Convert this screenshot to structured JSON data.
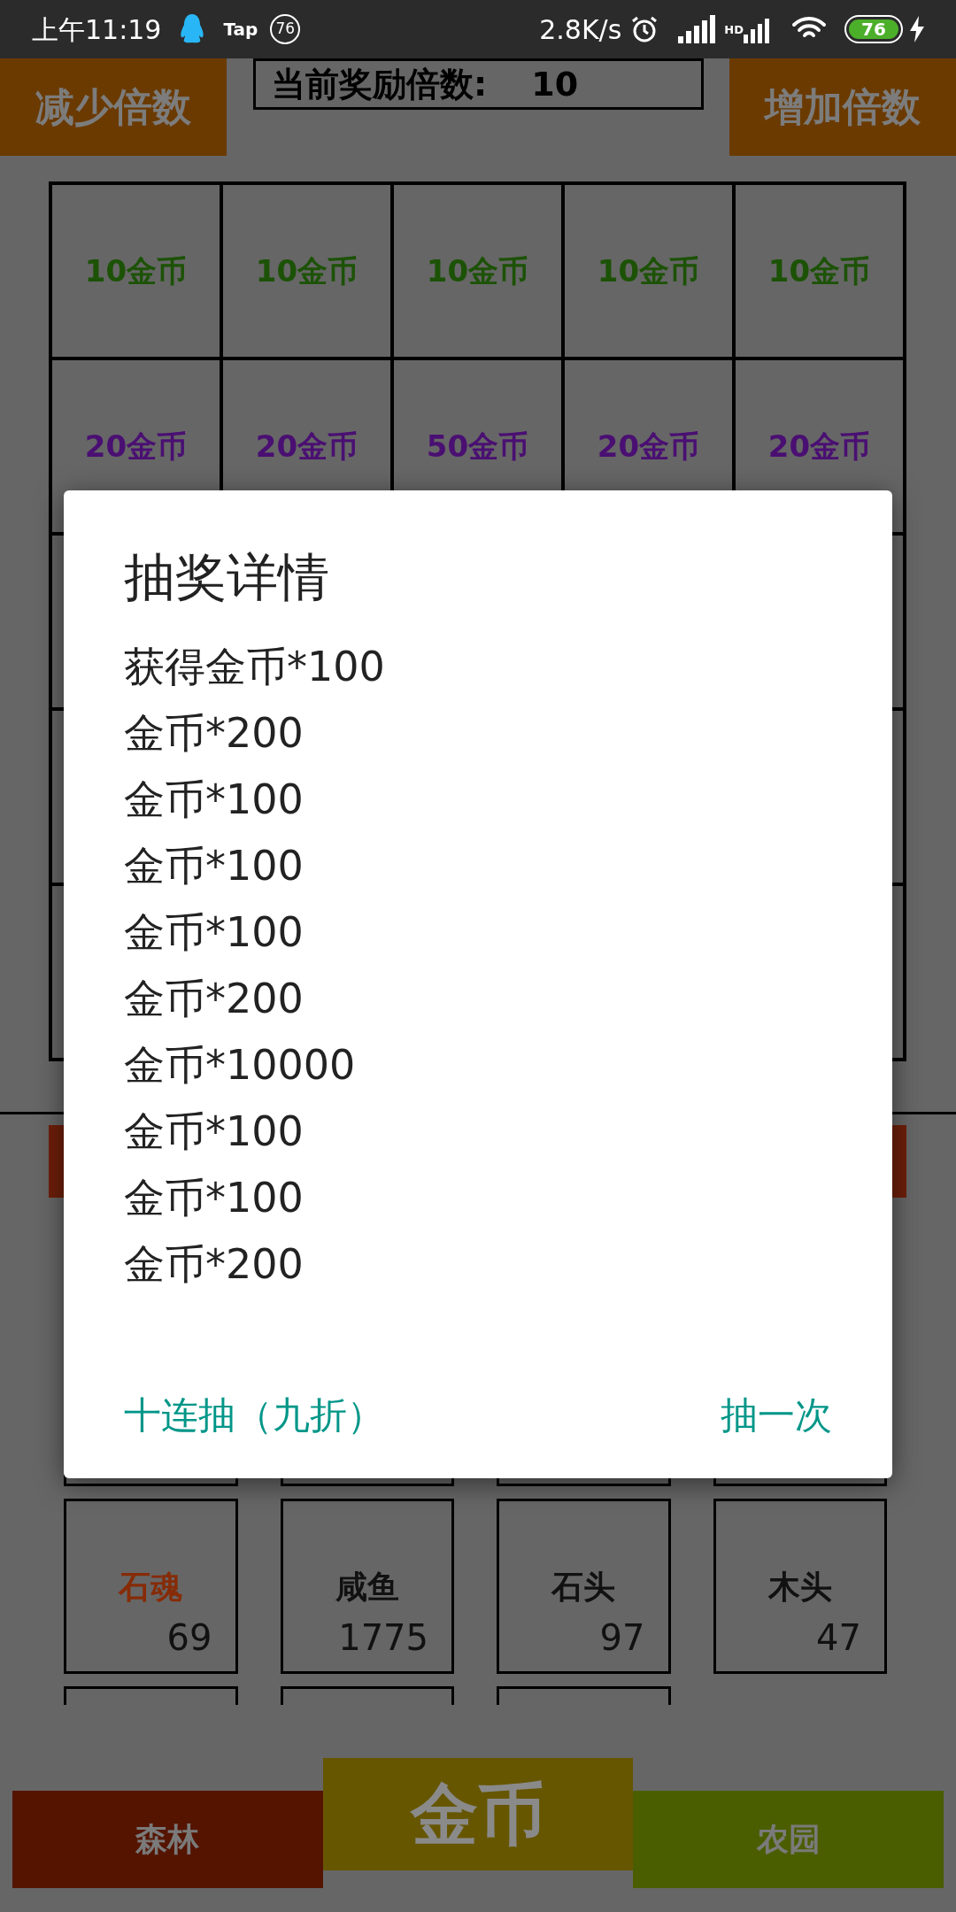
{
  "status_bar": {
    "time": "上午11:19",
    "app_label": "Tap",
    "badge": "76",
    "speed": "2.8K/s",
    "hd": "HD",
    "battery": "76"
  },
  "header": {
    "decrease": "减少倍数",
    "multiplier_label": "当前奖励倍数:",
    "multiplier_value": "10",
    "increase": "增加倍数"
  },
  "prize_grid": [
    [
      {
        "label": "10金币",
        "color": "#1c5206"
      },
      {
        "label": "10金币",
        "color": "#1c5206"
      },
      {
        "label": "10金币",
        "color": "#1c5206"
      },
      {
        "label": "10金币",
        "color": "#1c5206"
      },
      {
        "label": "10金币",
        "color": "#1c5206"
      }
    ],
    [
      {
        "label": "20金币",
        "color": "#4a0f72"
      },
      {
        "label": "20金币",
        "color": "#4a0f72"
      },
      {
        "label": "50金币",
        "color": "#4a0f72"
      },
      {
        "label": "20金币",
        "color": "#4a0f72"
      },
      {
        "label": "20金币",
        "color": "#4a0f72"
      }
    ]
  ],
  "items": [
    {
      "name": "石魂",
      "count": "69",
      "color": "#862b06"
    },
    {
      "name": "咸鱼",
      "count": "1775",
      "color": "#111111"
    },
    {
      "name": "石头",
      "count": "97",
      "color": "#111111"
    },
    {
      "name": "木头",
      "count": "47",
      "color": "#111111"
    }
  ],
  "dialog": {
    "title": "抽奖详情",
    "lines": [
      "获得金币*100",
      "金币*200",
      "金币*100",
      "金币*100",
      "金币*100",
      "金币*200",
      "金币*10000",
      "金币*100",
      "金币*100",
      "金币*200"
    ],
    "buttons": [
      "十连抽（九折）",
      "抽一次"
    ]
  },
  "nav": [
    {
      "label": "森林",
      "selected": false,
      "color": "#541400"
    },
    {
      "label": "金币",
      "selected": true,
      "color": "#665600"
    },
    {
      "label": "农园",
      "selected": false,
      "color": "#4a5e00"
    }
  ]
}
